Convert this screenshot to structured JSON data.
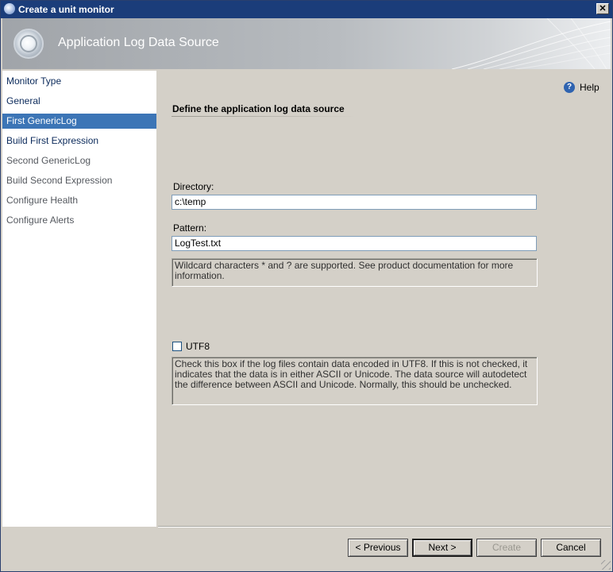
{
  "window": {
    "title": "Create a unit monitor",
    "close_glyph": "✕"
  },
  "banner": {
    "title": "Application Log Data Source"
  },
  "sidebar": {
    "items": [
      {
        "label": "Monitor Type",
        "state": "enabled"
      },
      {
        "label": "General",
        "state": "enabled"
      },
      {
        "label": "First GenericLog",
        "state": "selected"
      },
      {
        "label": "Build First Expression",
        "state": "enabled"
      },
      {
        "label": "Second GenericLog",
        "state": "disabled"
      },
      {
        "label": "Build Second Expression",
        "state": "disabled"
      },
      {
        "label": "Configure Health",
        "state": "disabled"
      },
      {
        "label": "Configure Alerts",
        "state": "disabled"
      }
    ]
  },
  "help": {
    "label": "Help",
    "icon": "question-icon",
    "glyph": "?"
  },
  "section": {
    "title": "Define the application log data source"
  },
  "directory": {
    "label": "Directory:",
    "value": "c:\\temp"
  },
  "pattern": {
    "label": "Pattern:",
    "value": "LogTest.txt",
    "note": "Wildcard characters * and ? are supported. See product documentation for more information."
  },
  "utf8": {
    "label": "UTF8",
    "checked": false,
    "note": "Check this box if the log files contain data encoded in UTF8. If this is not checked, it indicates that the data is in either ASCII or Unicode. The data source will autodetect the difference between ASCII and Unicode. Normally, this should be unchecked."
  },
  "buttons": {
    "previous": "< Previous",
    "next": "Next >",
    "create": "Create",
    "cancel": "Cancel"
  },
  "colors": {
    "titlebar": "#1b3d7a",
    "selected_nav": "#3c75b6",
    "dialog_bg": "#d4d0c8"
  }
}
